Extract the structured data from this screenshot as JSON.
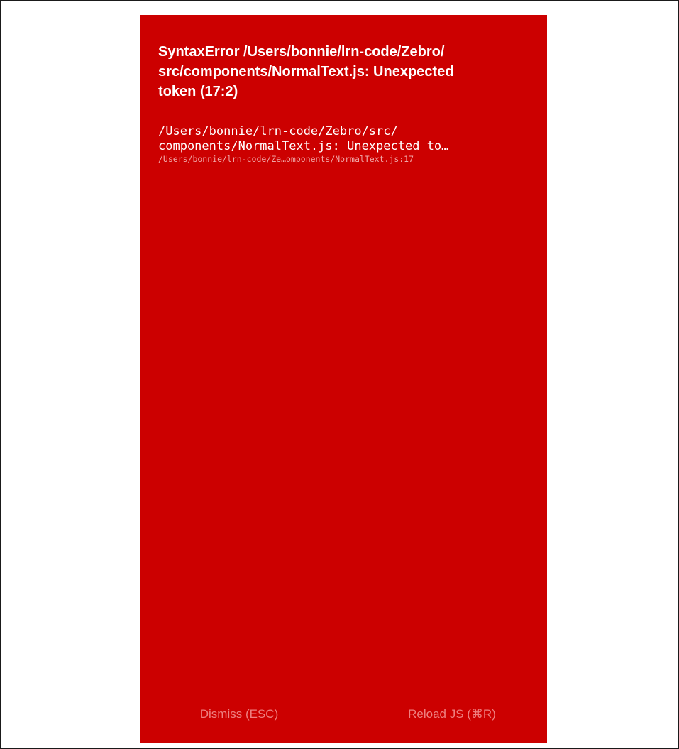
{
  "error": {
    "title": "SyntaxError /Users/bonnie/lrn-code/Zebro/\nsrc/components/NormalText.js: Unexpected\ntoken (17:2)",
    "stack_message": "/Users/bonnie/lrn-code/Zebro/src/\ncomponents/NormalText.js: Unexpected to…",
    "stack_location": "/Users/bonnie/lrn-code/Ze…omponents/NormalText.js:17"
  },
  "buttons": {
    "dismiss_label": "Dismiss (ESC)",
    "reload_label": "Reload JS (⌘R)"
  },
  "colors": {
    "background": "#cc0000",
    "text": "#ffffff",
    "button_text": "#ee8080"
  }
}
